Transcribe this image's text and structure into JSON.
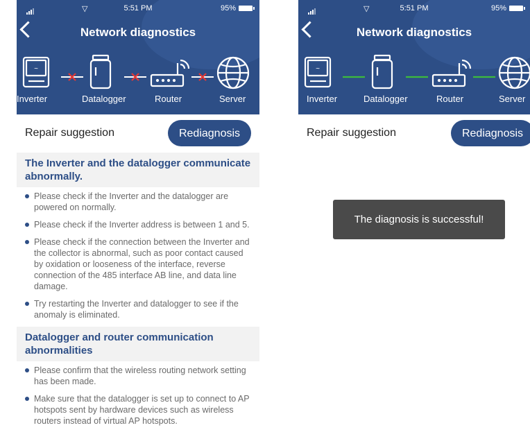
{
  "status": {
    "time": "5:51 PM",
    "battery": "95%",
    "signal_icon": "signal-icon",
    "wifi_icon": "wifi-icon"
  },
  "header": {
    "title": "Network diagnostics",
    "back_icon": "chevron-left-icon"
  },
  "devices": [
    {
      "label": "Inverter",
      "icon": "inverter-icon"
    },
    {
      "label": "Datalogger",
      "icon": "datalogger-icon"
    },
    {
      "label": "Router",
      "icon": "router-icon"
    },
    {
      "label": "Server",
      "icon": "globe-icon"
    }
  ],
  "left": {
    "links": [
      "failed",
      "failed",
      "failed"
    ],
    "repair_label": "Repair suggestion",
    "rediagnosis_label": "Rediagnosis",
    "problems": [
      {
        "title": "The Inverter and the datalogger communicate abnormally.",
        "tips": [
          "Please check if the Inverter and the datalogger are powered on normally.",
          "Please check if the Inverter address is between 1 and 5.",
          "Please check if the connection between the Inverter and the collector is abnormal, such as poor contact caused by oxidation or looseness of the interface, reverse connection of the 485 interface AB line, and data line damage.",
          "Try restarting the Inverter and datalogger to see if the anomaly is eliminated."
        ]
      },
      {
        "title": "Datalogger and router communication abnormalities",
        "tips": [
          "Please confirm that the wireless routing network setting has been made.",
          "Make sure that the datalogger is set up to connect to AP hotspots sent by hardware devices such as wireless routers instead of virtual AP hotspots."
        ]
      }
    ]
  },
  "right": {
    "links": [
      "ok",
      "ok",
      "ok"
    ],
    "repair_label": "Repair suggestion",
    "rediagnosis_label": "Rediagnosis",
    "toast": "The diagnosis is successful!"
  },
  "colors": {
    "header": "#2d4e86",
    "fail": "#e53935",
    "ok": "#3dbb3d",
    "toast": "#4a4a4a"
  }
}
